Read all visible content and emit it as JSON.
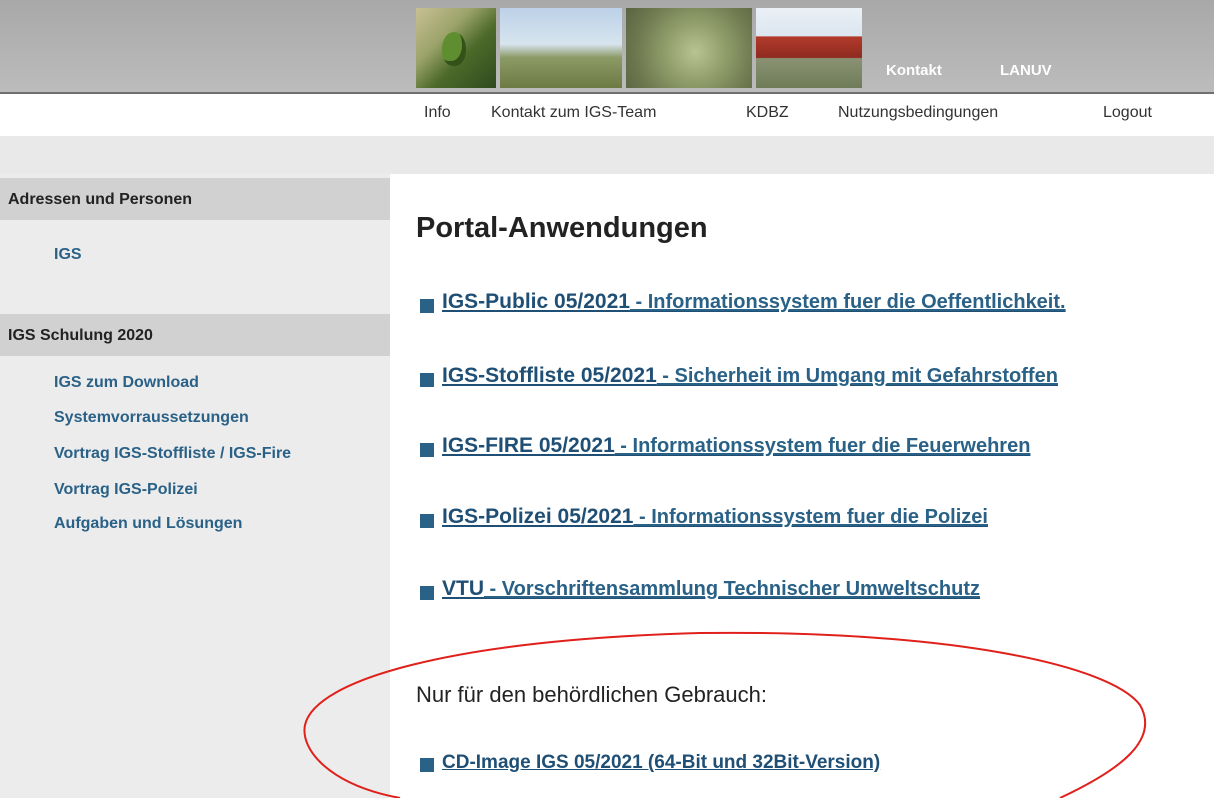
{
  "banner": {
    "links": [
      "Kontakt",
      "LANUV"
    ]
  },
  "topnav": {
    "items": [
      "Info",
      "Kontakt zum IGS-Team",
      "KDBZ",
      "Nutzungsbedingungen",
      "Logout"
    ]
  },
  "sidebar": {
    "sections": [
      {
        "title": "Adressen und Personen",
        "items": [
          "IGS"
        ]
      },
      {
        "title": "IGS Schulung 2020",
        "items": [
          "IGS zum Download",
          "Systemvorraussetzungen",
          "Vortrag IGS-Stoffliste / IGS-Fire",
          "Vortrag IGS-Polizei",
          "Aufgaben und Lösungen"
        ]
      }
    ]
  },
  "main": {
    "title": "Portal-Anwendungen",
    "apps": [
      {
        "name": "IGS-Public 05/2021",
        "desc": " - Informationssystem fuer die Oeffentlichkeit."
      },
      {
        "name": "IGS-Stoffliste 05/2021",
        "desc": " - Sicherheit im Umgang mit Gefahrstoffen"
      },
      {
        "name": "IGS-FIRE 05/2021",
        "desc": " - Informationssystem fuer die Feuerwehren"
      },
      {
        "name": "IGS-Polizei 05/2021",
        "desc": " - Informationssystem fuer die Polizei"
      },
      {
        "name": "VTU",
        "desc": " - Vorschriftensammlung Technischer Umweltschutz"
      }
    ],
    "restricted": {
      "heading": "Nur für den behördlichen Gebrauch:",
      "link": "CD-Image IGS 05/2021 (64-Bit und 32Bit-Version)"
    }
  },
  "colors": {
    "link": "#2a6187",
    "annotation": "#e0201b",
    "sidebar_bg": "#ececec"
  }
}
